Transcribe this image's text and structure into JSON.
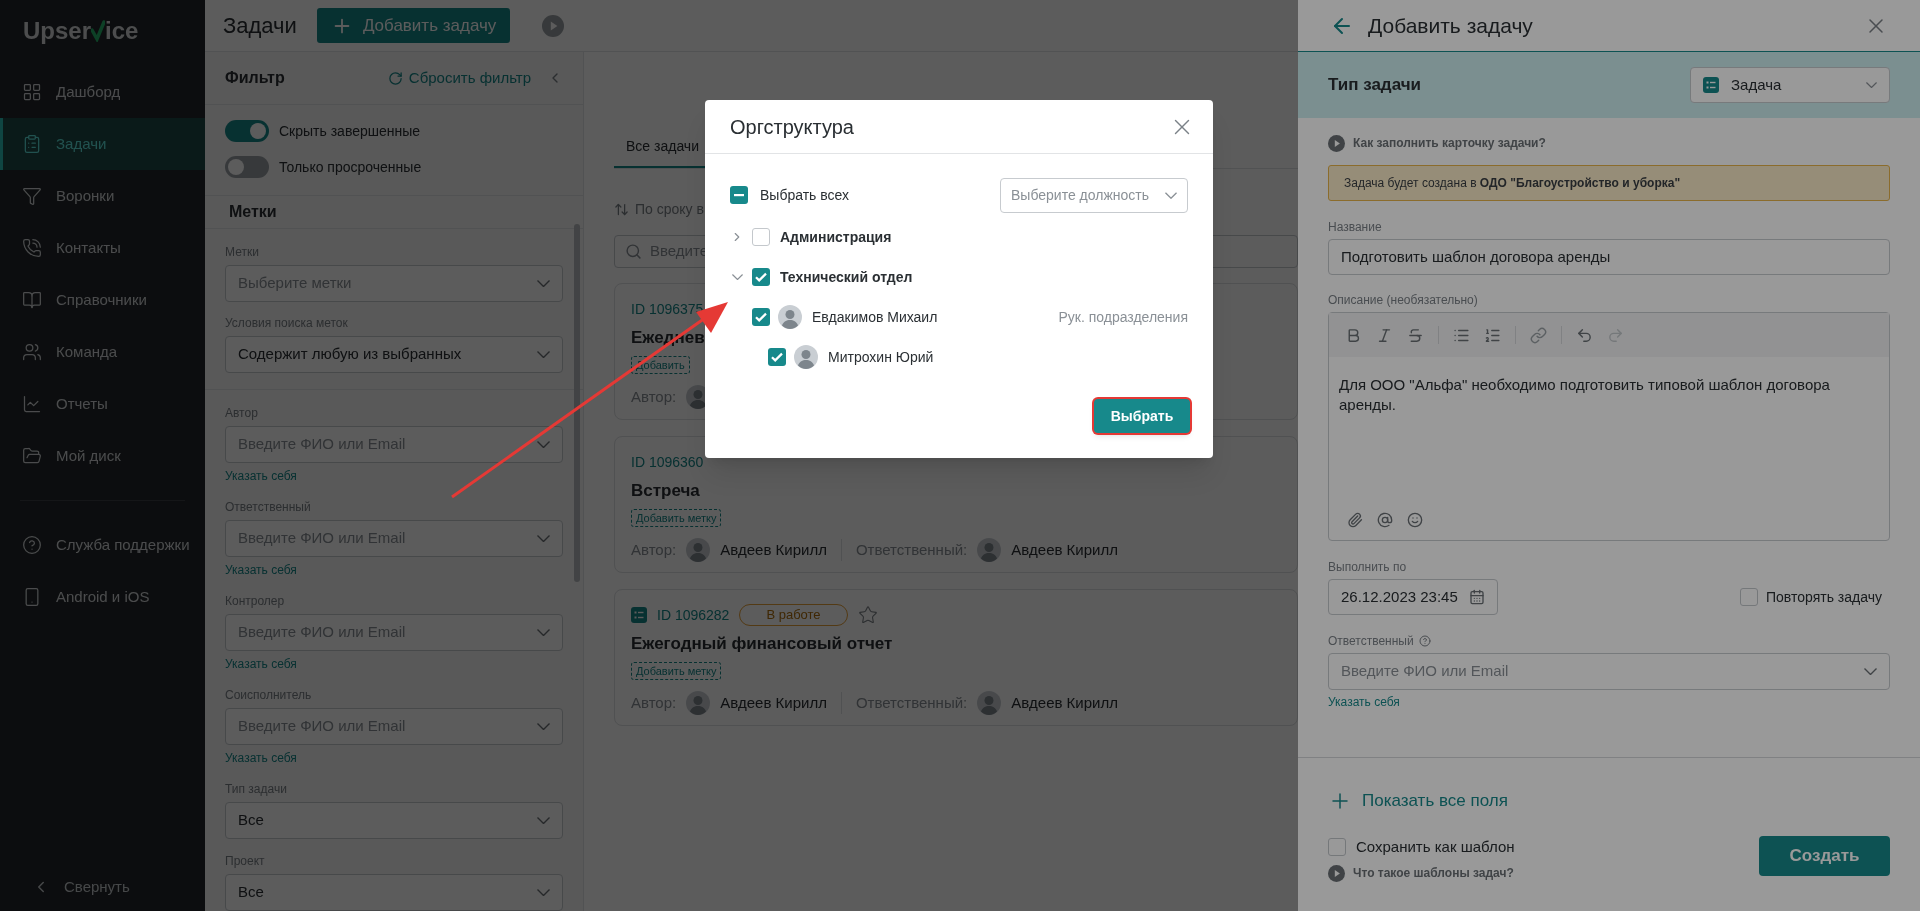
{
  "sidebar": {
    "logo": {
      "before": "Upser",
      "after": "ice"
    },
    "items": [
      {
        "kind": "dashboard",
        "label": "Дашборд",
        "selected": false
      },
      {
        "kind": "tasks",
        "label": "Задачи",
        "selected": true
      },
      {
        "kind": "funnel",
        "label": "Воронки",
        "selected": false
      },
      {
        "kind": "contacts",
        "label": "Контакты",
        "selected": false
      },
      {
        "kind": "book",
        "label": "Справочники",
        "selected": false
      },
      {
        "kind": "team",
        "label": "Команда",
        "selected": false
      },
      {
        "kind": "reports",
        "label": "Отчеты",
        "selected": false
      },
      {
        "kind": "folder",
        "label": "Мой диск",
        "selected": false
      }
    ],
    "bottom_items": [
      {
        "kind": "help",
        "label": "Служба поддержки"
      },
      {
        "kind": "phone",
        "label": "Android и iOS"
      }
    ],
    "collapse": "Свернуть"
  },
  "header": {
    "title": "Задачи",
    "add_button": "Добавить задачу"
  },
  "filter": {
    "title": "Фильтр",
    "reset": "Сбросить фильтр",
    "toggles": [
      {
        "label": "Скрыть завершенные",
        "on": true
      },
      {
        "label": "Только просроченные",
        "on": false
      }
    ],
    "tags_title": "Метки",
    "tag_fields": [
      {
        "label": "Метки",
        "placeholder": "Выберите метки"
      },
      {
        "label": "Условия поиска меток",
        "value": "Содержит любую из выбранных"
      }
    ],
    "fields": [
      {
        "label": "Автор",
        "placeholder": "Введите ФИО или Email",
        "link": "Указать себя"
      },
      {
        "label": "Ответственный",
        "placeholder": "Введите ФИО или Email",
        "link": "Указать себя"
      },
      {
        "label": "Контролер",
        "placeholder": "Введите ФИО или Email",
        "link": "Указать себя"
      },
      {
        "label": "Соисполнитель",
        "placeholder": "Введите ФИО или Email",
        "link": "Указать себя"
      },
      {
        "label": "Тип задачи",
        "value": "Все"
      },
      {
        "label": "Проект",
        "value": "Все"
      }
    ]
  },
  "list": {
    "tabs": [
      {
        "label": "Все задачи",
        "selected": true
      }
    ],
    "sort": "По сроку в",
    "search": {
      "placeholder": "Введите"
    },
    "cards": [
      {
        "kind": "plain",
        "id": "ID 1096375",
        "title": "Ежеднев",
        "tag": "Добавить",
        "author_label": "Автор:"
      },
      {
        "kind": "plain",
        "id": "ID 1096360",
        "title": "Встреча",
        "tag": "Добавить метку",
        "author_label": "Автор:",
        "author": "Авдеев Кирилл",
        "responsible_label": "Ответственный:",
        "responsible": "Авдеев Кирилл"
      },
      {
        "kind": "task",
        "id": "ID 1096282",
        "status": "В работе",
        "starred": false,
        "title": "Ежегодный финансовый отчет",
        "tag": "Добавить метку",
        "author_label": "Автор:",
        "author": "Авдеев Кирилл",
        "responsible_label": "Ответственный:",
        "responsible": "Авдеев Кирилл"
      }
    ]
  },
  "drawer": {
    "title": "Добавить задачу",
    "type_label": "Тип задачи",
    "type_value": "Задача",
    "help_link": "Как заполнить карточку задачи?",
    "notice": "Задача будет создана в **ОДО \"Благоустройство и уборка\"**",
    "name_label": "Название",
    "name_value": "Подготовить шаблон договора аренды",
    "desc_label": "Описание (необязательно)",
    "desc_value": "Для ООО \"Альфа\" необходимо подготовить типовой шаблон договора аренды.",
    "due_label": "Выполнить по",
    "due_value": "26.12.2023 23:45",
    "repeat": {
      "label": "Повторять задачу",
      "checked": false
    },
    "resp_label": "Ответственный",
    "resp_placeholder": "Введите ФИО или Email",
    "resp_link": "Указать себя",
    "show_all": "Показать все поля",
    "template": {
      "label": "Сохранить как шаблон",
      "checked": false
    },
    "template_help": "Что такое шаблоны задач?",
    "create": "Создать"
  },
  "modal": {
    "title": "Оргструктура",
    "select_all": {
      "label": "Выбрать всех",
      "checked": true,
      "partial": true
    },
    "position": {
      "placeholder": "Выберите должность"
    },
    "tree": [
      {
        "label": "Администрация",
        "expanded": false,
        "checked": false
      },
      {
        "label": "Технический отдел",
        "expanded": true,
        "checked": true,
        "children": [
          {
            "label": "Евдакимов Михаил",
            "role": "Рук. подразделения",
            "checked": true,
            "children": [
              {
                "label": "Митрохин Юрий",
                "checked": true
              }
            ]
          }
        ]
      }
    ],
    "button": "Выбрать"
  }
}
